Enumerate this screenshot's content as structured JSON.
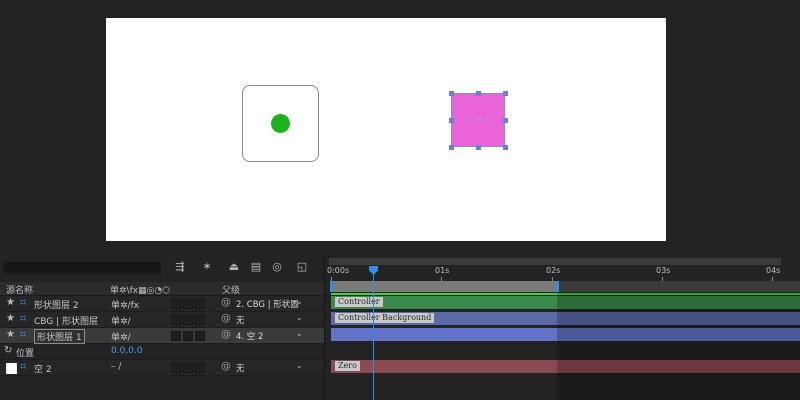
{
  "columns": {
    "source_name": "源名称",
    "switches_icons": "单✲\\fx▦◎◔⬡",
    "parent": "父级"
  },
  "layers": [
    {
      "name": "形状图层 2",
      "switches": "单✲/fx",
      "parent": "2. CBG | 形状圖",
      "selected": false,
      "boxed": false
    },
    {
      "name": "CBG | 形状图层",
      "switches": "单✲/",
      "parent": "无",
      "selected": false,
      "boxed": false
    },
    {
      "name": "形状图层 1",
      "switches": "单✲/",
      "parent": "4. 空 2",
      "selected": true,
      "boxed": true
    },
    {
      "name": "空 2",
      "switches": "⎯ /",
      "parent": "无",
      "selected": false,
      "boxed": false
    }
  ],
  "property": {
    "name": "位置",
    "value": "0.0,0.0"
  },
  "ruler": [
    "0:00s",
    "01s",
    "02s",
    "03s",
    "04s"
  ],
  "bars": [
    {
      "label": "Controller",
      "color": "#3a8a4e"
    },
    {
      "label": "Controller Background",
      "color": "#5a6aa8"
    },
    {
      "label": "",
      "color": "#6272c4"
    },
    {
      "label": "Zero",
      "color": "#8a4a52"
    }
  ],
  "canvas": {
    "controller_dot_color": "#1db31d",
    "square_color": "#ea64d9"
  }
}
